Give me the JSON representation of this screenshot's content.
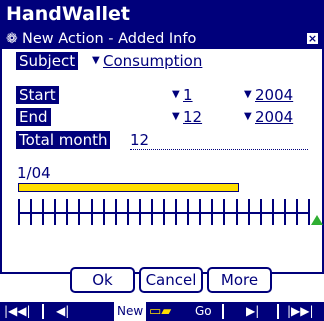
{
  "app": {
    "title": "HandWallet"
  },
  "dialog": {
    "title": "New Action - Added Info",
    "close_glyph": "×",
    "subject": {
      "label": "Subject",
      "value": "Consumption"
    },
    "start": {
      "label": "Start",
      "month": "1",
      "year": "2004"
    },
    "end": {
      "label": "End",
      "month": "12",
      "year": "2004"
    },
    "total": {
      "label": "Total month",
      "value": "12"
    },
    "timeline": {
      "label": "1/04",
      "progress_fraction": 0.75,
      "ticks": 24,
      "marker_color": "#2fae32"
    },
    "buttons": {
      "ok": "Ok",
      "cancel": "Cancel",
      "more": "More"
    }
  },
  "command_bar": {
    "first": "|◀◀|",
    "prev": "◀|",
    "new": "New",
    "go": "Go",
    "next": "▶|",
    "last": "|▶▶|"
  },
  "colors": {
    "navy": "#00007b",
    "yellow": "#ffde00",
    "green": "#2fae32"
  },
  "icons": {
    "title_icon": "gear-icon",
    "close": "close-icon",
    "marker": "triangle-icon",
    "gift": "gift-icon"
  }
}
